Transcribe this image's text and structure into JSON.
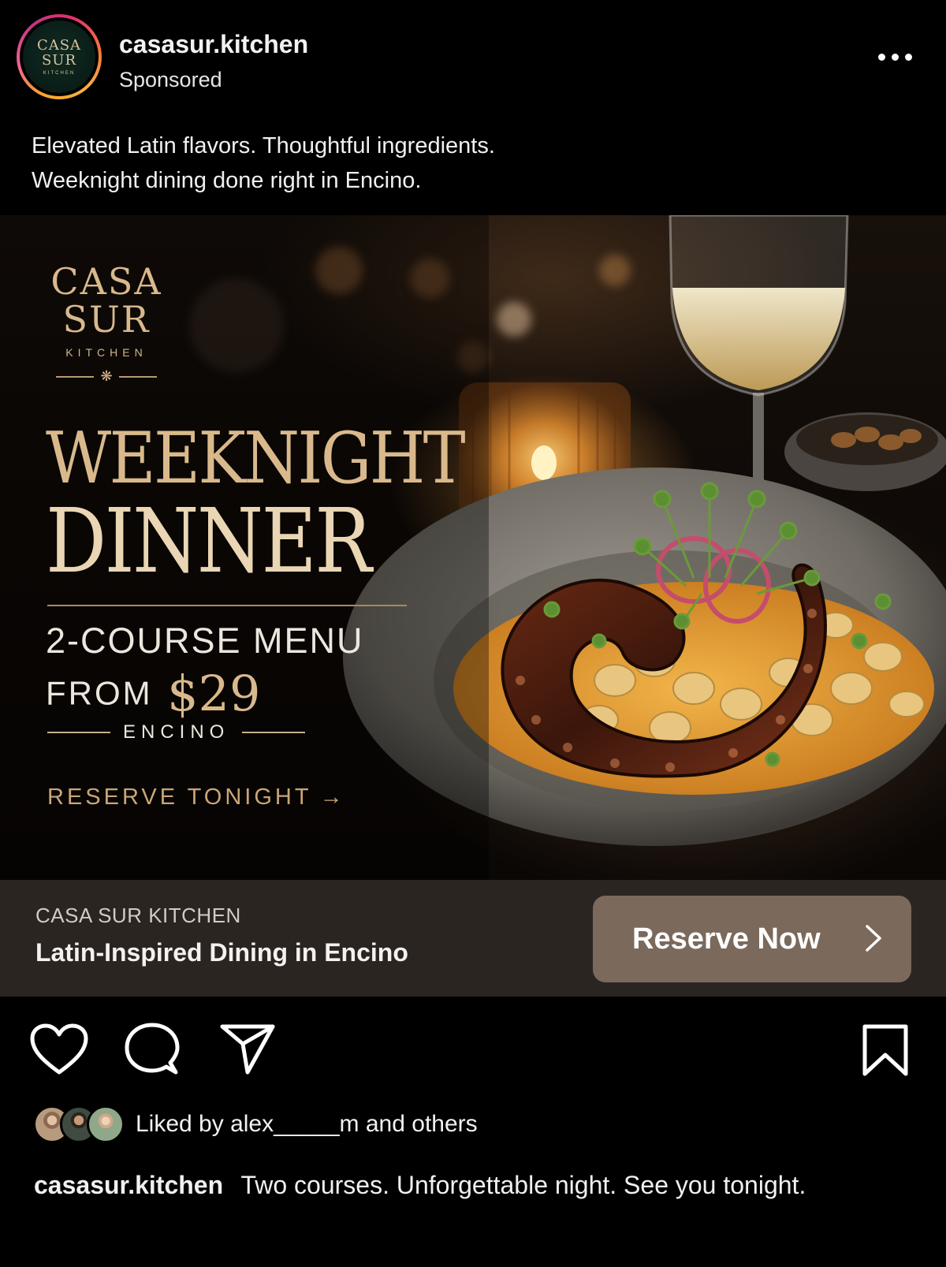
{
  "post": {
    "username": "casasur.kitchen",
    "sponsored_label": "Sponsored",
    "avatar_text": {
      "line1": "CASA",
      "line2": "SUR",
      "line3": "KITCHEN"
    },
    "caption_line1": "Elevated Latin flavors. Thoughtful ingredients.",
    "caption_line2": "Weeknight dining done right in Encino."
  },
  "creative": {
    "logo": {
      "line1": "CASA",
      "line2": "SUR",
      "line3": "KITCHEN",
      "ornament": "❋"
    },
    "headline_1": "WEEKNIGHT",
    "headline_2": "DINNER",
    "menu_line": "2-COURSE MENU",
    "from_word": "FROM",
    "price": "$29",
    "location": "ENCINO",
    "reserve_cta": "RESERVE TONIGHT",
    "reserve_arrow": "→"
  },
  "cta_bar": {
    "brand": "CASA SUR KITCHEN",
    "description": "Latin-Inspired Dining in Encino",
    "button_label": "Reserve Now"
  },
  "likes": {
    "prefix": "Liked by ",
    "user": "alex_____m",
    "suffix": " and others"
  },
  "caption": {
    "username": "casasur.kitchen",
    "text": "Two courses. Unforgettable night. See you tonight."
  },
  "icons": [
    "more-icon",
    "heart-icon",
    "comment-icon",
    "share-icon",
    "bookmark-icon",
    "chevron-right-icon",
    "arrow-right-icon"
  ],
  "colors": {
    "gold": "#d9b98c",
    "cta_bar": "#2b2522",
    "cta_button": "#7b695c",
    "background": "#000000"
  }
}
